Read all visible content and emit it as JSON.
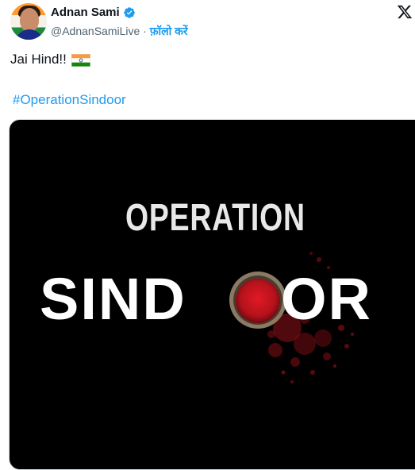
{
  "author": {
    "display_name": "Adnan Sami",
    "handle": "@AdnanSamiLive",
    "separator": "·",
    "follow_label": "फ़ॉलो करें",
    "verified": true
  },
  "tweet": {
    "text": "Jai Hind!!",
    "emoji": "indian-flag",
    "hashtag": "#OperationSindoor"
  },
  "media": {
    "line1": "OPERATION",
    "line2_left": "SIND",
    "line2_right": "OR",
    "bowl_color": "#b5121b"
  },
  "colors": {
    "link": "#1d9bf0",
    "text": "#0f1419",
    "muted": "#536471",
    "media_bg": "#000000"
  },
  "icons": [
    "verified-badge-icon",
    "x-logo-icon",
    "indian-flag-icon"
  ]
}
